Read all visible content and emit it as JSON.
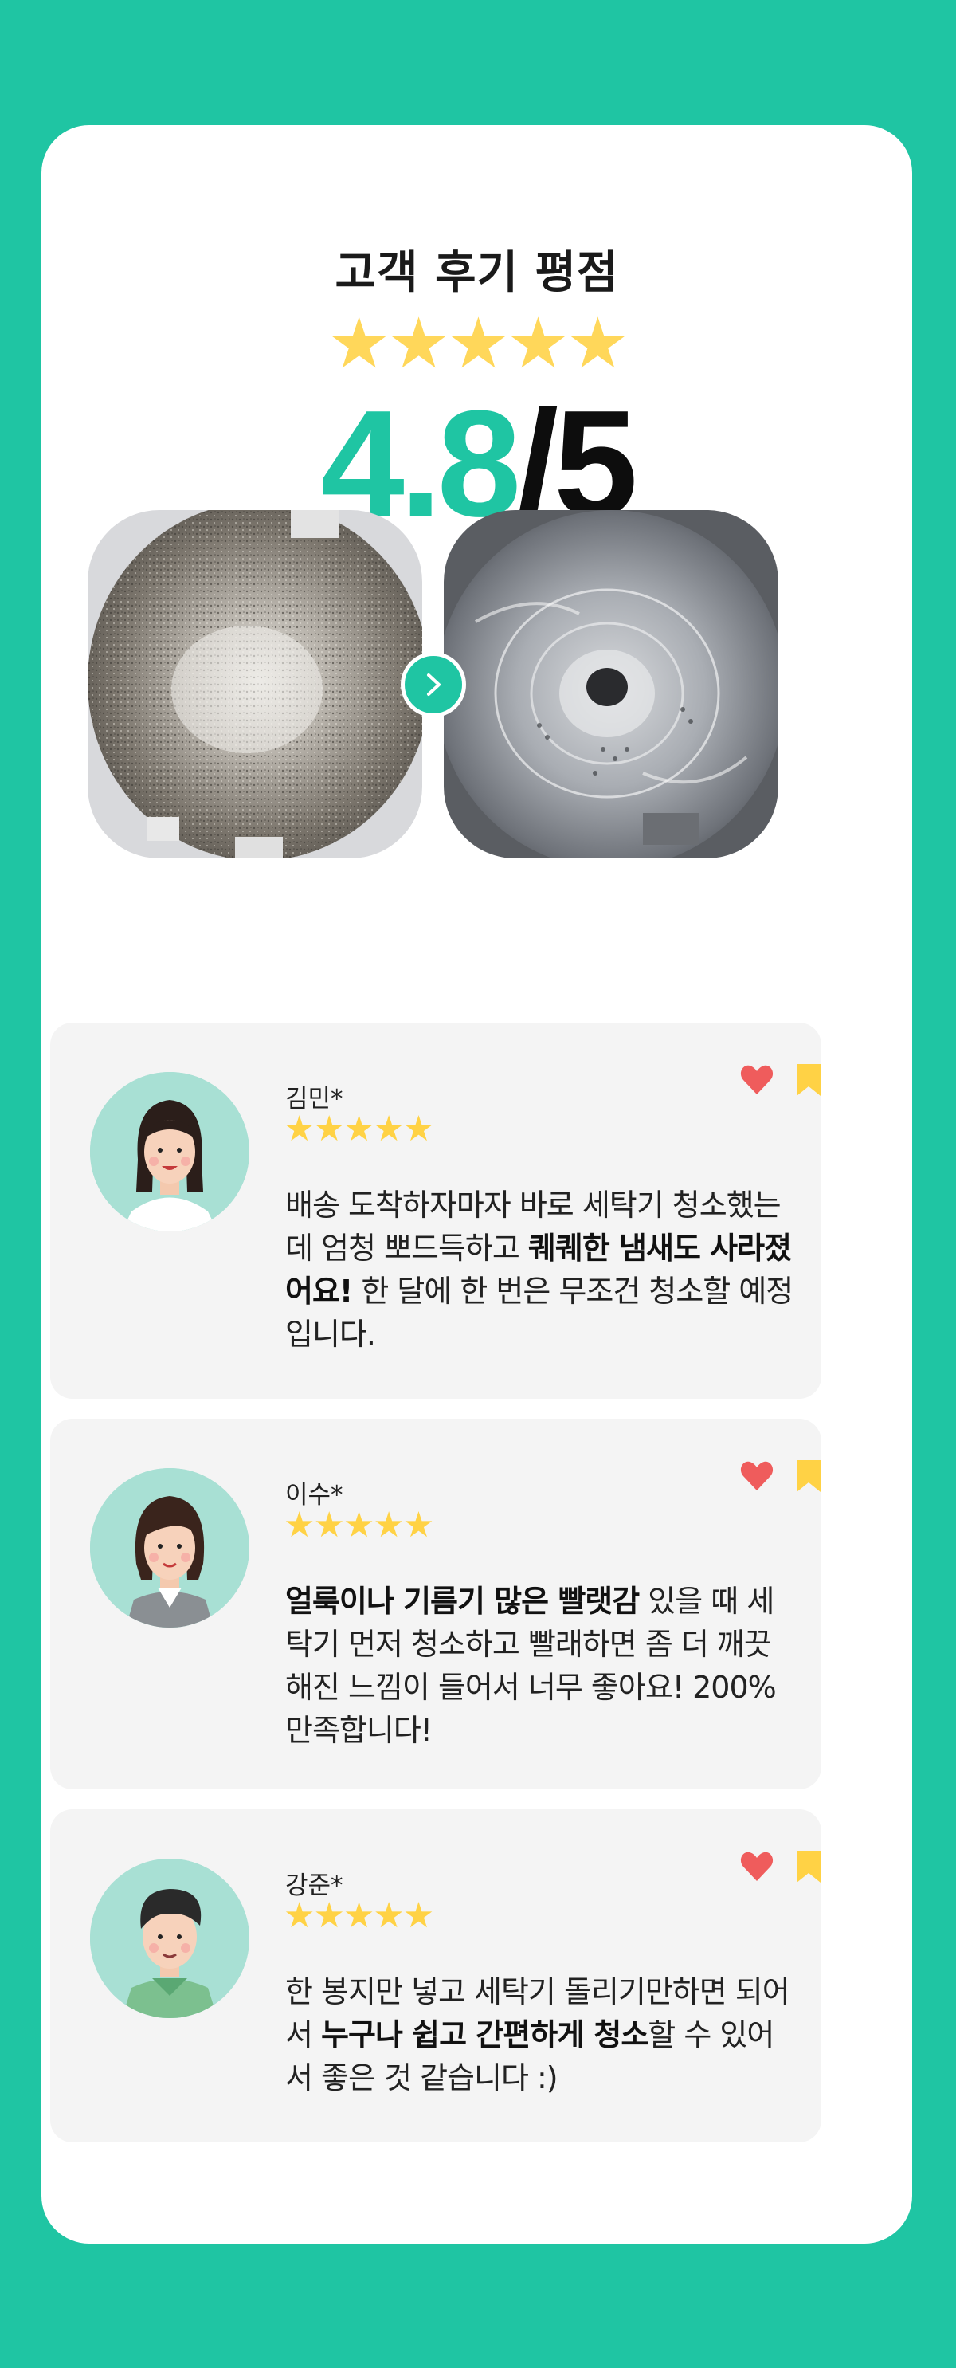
{
  "header": {
    "title": "고객 후기 평점",
    "stars": "★★★★★",
    "rating_value": "4.8",
    "rating_total": "/5"
  },
  "photos": {
    "before": "washing-machine-drum-before",
    "after": "washing-machine-drum-after",
    "arrow_icon": "chevron-right-icon"
  },
  "reviews": [
    {
      "name": "김민*",
      "stars": "★★★★★",
      "text_parts": [
        "배송 도착하자마자 바로 세탁기 청소했는데 엄청 뽀드득하고 ",
        "퀘퀘한 냄새도 사라졌어요!",
        " 한 달에 한 번은 무조건 청소할 예정입니다."
      ]
    },
    {
      "name": "이수*",
      "stars": "★★★★★",
      "text_parts": [
        "얼룩이나 기름기 많은 빨랫감",
        " 있을 때 세탁기 먼저 청소하고 빨래하면 좀 더 깨끗해진 느낌이 들어서 너무 좋아요! 200% 만족합니다!"
      ]
    },
    {
      "name": "강준*",
      "stars": "★★★★★",
      "text_parts": [
        "한 봉지만 넣고 세탁기 돌리기만하면 되어서 ",
        "누구나 쉽고 간편하게 청소",
        "할 수 있어서 좋은 것 같습니다 :)"
      ]
    }
  ],
  "colors": {
    "accent": "#1fc5a3",
    "star": "#ffd245",
    "heart": "#ef5c5c",
    "bookmark": "#ffd245"
  }
}
